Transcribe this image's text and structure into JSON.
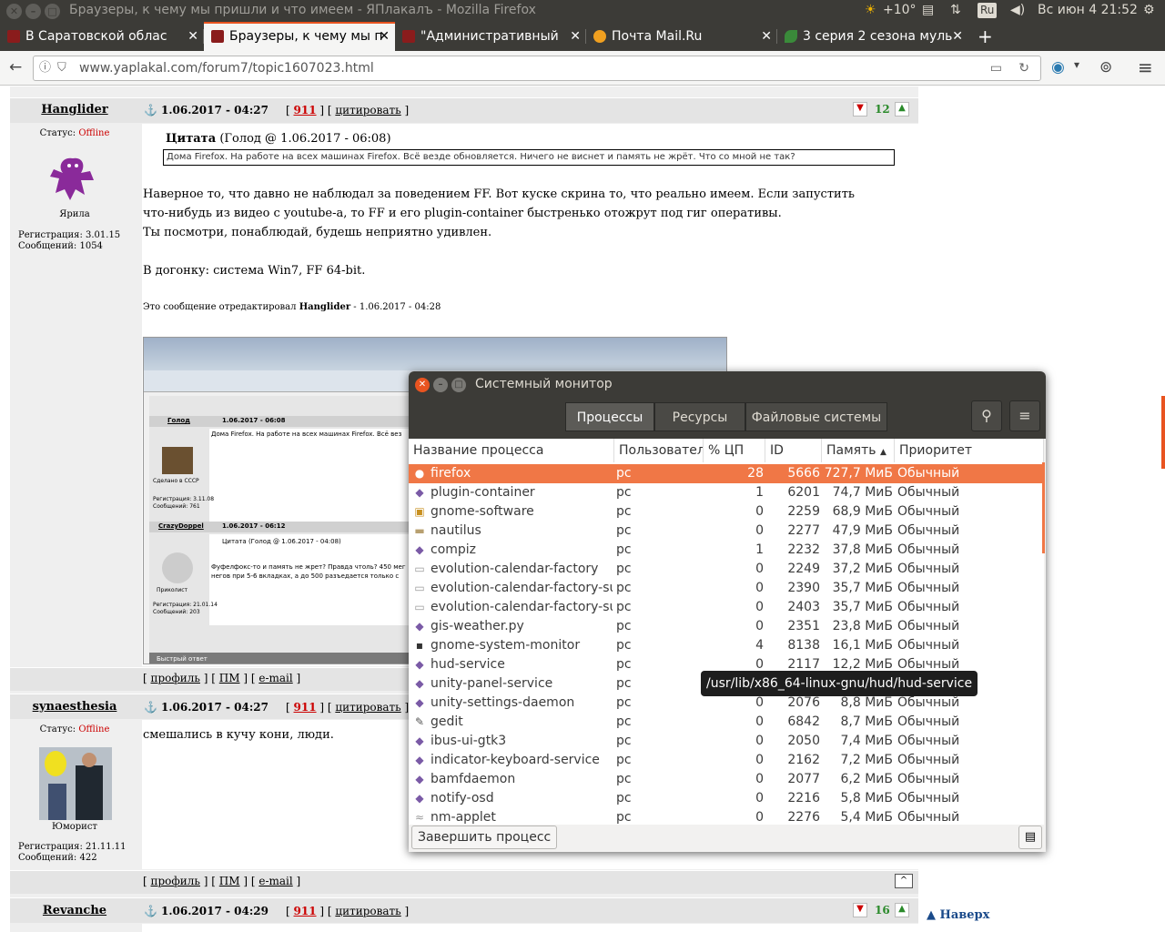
{
  "panel": {
    "window_title": "Браузеры, к чему мы пришли и что имеем - ЯПлакалъ - Mozilla Firefox",
    "weather": "+10°",
    "kbd": "Ru",
    "clock": "Вс июн  4 21:52"
  },
  "tabs": [
    {
      "label": "В Саратовской облас",
      "icon": "yaplakal-icon",
      "active": false
    },
    {
      "label": "Браузеры, к чему мы п",
      "icon": "yaplakal-icon",
      "active": true
    },
    {
      "label": "\"Административный",
      "icon": "yaplakal-icon",
      "active": false
    },
    {
      "label": "Почта Mail.Ru",
      "icon": "mail-icon",
      "active": false
    },
    {
      "label": "3 серия 2 сезона муль",
      "icon": "leaf-icon",
      "active": false
    }
  ],
  "nav": {
    "url": "www.yaplakal.com/forum7/topic1607023.html"
  },
  "posts": [
    {
      "author": "Hanglider",
      "date": "1.06.2017 - 04:27",
      "num": "911",
      "quote_btn": "цитировать",
      "rating": "12",
      "status_label": "Статус:",
      "status": "Offline",
      "rank": "Ярила",
      "reg": "Регистрация: 3.01.15",
      "msgs": "Сообщений: 1054",
      "quote_title": "Цитата",
      "quote_meta": "(Голод @ 1.06.2017 - 06:08)",
      "quote_text": "Дома Firefox. На работе на всех машинах Firefox. Всё везде обновляется. Ничего не виснет и память не жрёт. Что со мной не так?",
      "body1": "Наверное то, что давно не наблюдал за поведением FF. Вот куске скрина то, что реально имеем. Если запустить",
      "body2": "что-нибудь из видео с youtube-а, то FF и его plugin-container быстренько отожрут под гиг оперативы.",
      "body3": "Ты посмотри, понаблюдай, будешь неприятно удивлен.",
      "body4": "В догонку: система Win7, FF 64-bit.",
      "edit_prefix": "Это сообщение отредактировал",
      "edit_user": "Hanglider",
      "edit_date": "- 1.06.2017 - 04:28"
    },
    {
      "author": "synaesthesia",
      "date": "1.06.2017 - 04:27",
      "num": "911",
      "quote_btn": "цитировать",
      "status_label": "Статус:",
      "status": "Offline",
      "rank": "Юморист",
      "reg": "Регистрация: 21.11.11",
      "msgs": "Сообщений: 422",
      "body1": "смешались в кучу кони, люди."
    },
    {
      "author": "Revanche",
      "date": "1.06.2017 - 04:29",
      "num": "911",
      "quote_btn": "цитировать",
      "rating": "16"
    }
  ],
  "footer_links": {
    "profile": "профиль",
    "pm": "ПМ",
    "email": "e-mail"
  },
  "nav_up": "Наверх",
  "embedded": {
    "user1": "Голод",
    "date1": "1.06.2017 - 06:08",
    "text1": "Дома Firefox. На работе на всех машинах Firefox. Всё вез",
    "rank1": "Сделано в СССР",
    "reg1": "Регистрация: 3.11.08",
    "msgs1": "Сообщений: 761",
    "user2": "CrazyDoppel",
    "date2": "1.06.2017 - 06:12",
    "quote2": "Цитата (Голод @ 1.06.2017 - 04:08)",
    "text2a": "Фуфелфокс-то и память не жрет? Правда чтоль? 450 мег",
    "text2b": "негов при 5-6 вкладках, а до 500 разъедается только с",
    "rank2": "Приколист",
    "reg2": "Регистрация: 21.01.14",
    "msgs2": "Сообщений: 203",
    "fast_reply": "Быстрый ответ"
  },
  "sysmon": {
    "title": "Системный монитор",
    "tabs": [
      "Процессы",
      "Ресурсы",
      "Файловые системы"
    ],
    "columns": [
      "Название процесса",
      "Пользовател",
      "% ЦП",
      "ID",
      "Память",
      "Приоритет"
    ],
    "rows": [
      {
        "name": "firefox",
        "user": "pc",
        "cpu": "28",
        "id": "5666",
        "mem": "727,7 МиБ",
        "prio": "Обычный"
      },
      {
        "name": "plugin-container",
        "user": "pc",
        "cpu": "1",
        "id": "6201",
        "mem": "74,7 МиБ",
        "prio": "Обычный"
      },
      {
        "name": "gnome-software",
        "user": "pc",
        "cpu": "0",
        "id": "2259",
        "mem": "68,9 МиБ",
        "prio": "Обычный"
      },
      {
        "name": "nautilus",
        "user": "pc",
        "cpu": "0",
        "id": "2277",
        "mem": "47,9 МиБ",
        "prio": "Обычный"
      },
      {
        "name": "compiz",
        "user": "pc",
        "cpu": "1",
        "id": "2232",
        "mem": "37,8 МиБ",
        "prio": "Обычный"
      },
      {
        "name": "evolution-calendar-factory",
        "user": "pc",
        "cpu": "0",
        "id": "2249",
        "mem": "37,2 МиБ",
        "prio": "Обычный"
      },
      {
        "name": "evolution-calendar-factory-su",
        "user": "pc",
        "cpu": "0",
        "id": "2390",
        "mem": "35,7 МиБ",
        "prio": "Обычный"
      },
      {
        "name": "evolution-calendar-factory-su",
        "user": "pc",
        "cpu": "0",
        "id": "2403",
        "mem": "35,7 МиБ",
        "prio": "Обычный"
      },
      {
        "name": "gis-weather.py",
        "user": "pc",
        "cpu": "0",
        "id": "2351",
        "mem": "23,8 МиБ",
        "prio": "Обычный"
      },
      {
        "name": "gnome-system-monitor",
        "user": "pc",
        "cpu": "4",
        "id": "8138",
        "mem": "16,1 МиБ",
        "prio": "Обычный"
      },
      {
        "name": "hud-service",
        "user": "pc",
        "cpu": "0",
        "id": "2117",
        "mem": "12,2 МиБ",
        "prio": "Обычный"
      },
      {
        "name": "unity-panel-service",
        "user": "pc",
        "cpu": "",
        "id": "",
        "mem": "",
        "prio": ""
      },
      {
        "name": "unity-settings-daemon",
        "user": "pc",
        "cpu": "0",
        "id": "2076",
        "mem": "8,8 МиБ",
        "prio": "Обычный"
      },
      {
        "name": "gedit",
        "user": "pc",
        "cpu": "0",
        "id": "6842",
        "mem": "8,7 МиБ",
        "prio": "Обычный"
      },
      {
        "name": "ibus-ui-gtk3",
        "user": "pc",
        "cpu": "0",
        "id": "2050",
        "mem": "7,4 МиБ",
        "prio": "Обычный"
      },
      {
        "name": "indicator-keyboard-service",
        "user": "pc",
        "cpu": "0",
        "id": "2162",
        "mem": "7,2 МиБ",
        "prio": "Обычный"
      },
      {
        "name": "bamfdaemon",
        "user": "pc",
        "cpu": "0",
        "id": "2077",
        "mem": "6,2 МиБ",
        "prio": "Обычный"
      },
      {
        "name": "notify-osd",
        "user": "pc",
        "cpu": "0",
        "id": "2216",
        "mem": "5,8 МиБ",
        "prio": "Обычный"
      },
      {
        "name": "nm-applet",
        "user": "pc",
        "cpu": "0",
        "id": "2276",
        "mem": "5,4 МиБ",
        "prio": "Обычный"
      }
    ],
    "end_process": "Завершить процесс",
    "tooltip": "/usr/lib/x86_64-linux-gnu/hud/hud-service"
  }
}
